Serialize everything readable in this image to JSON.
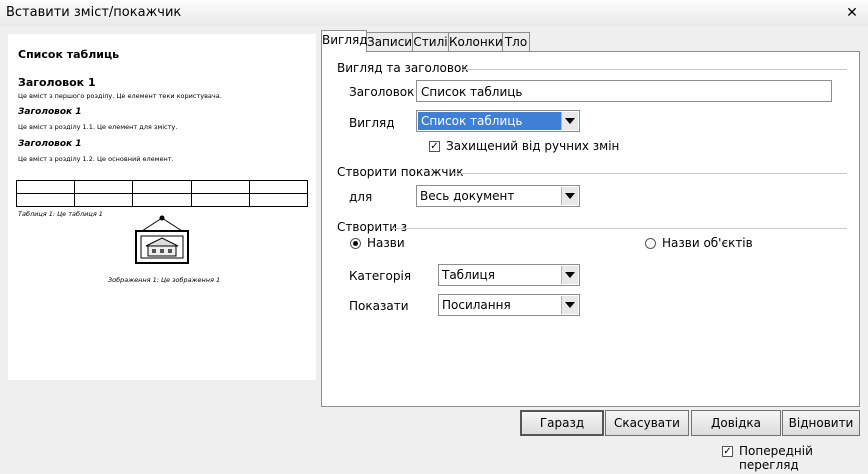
{
  "window": {
    "title": "Вставити зміст/покажчик",
    "close_glyph": "✕"
  },
  "preview": {
    "title": "Список таблиць",
    "heading1": "Заголовок 1",
    "text1": "Це вміст з першого розділу. Це елемент теки користувача.",
    "heading11": "Заголовок 1",
    "text11": "Це вміст з розділу 1.1. Це елемент для змісту.",
    "heading12": "Заголовок 1",
    "text12": "Це вміст з розділу 1.2. Це основний елемент.",
    "table_caption": "Таблиця 1: Це таблиця 1",
    "image_caption": "Зображення 1: Це зображення 1"
  },
  "tabs": [
    "Вигляд",
    "Записи",
    "Стилі",
    "Колонки",
    "Тло"
  ],
  "active_tab": "Вигляд",
  "appearance": {
    "section_label": "Вигляд та заголовок",
    "title_label": "Заголовок",
    "title_value": "Список таблиць",
    "type_label": "Вигляд",
    "type_value": "Список таблиць",
    "protected_label": "Захищений від ручних змін",
    "protected_checked": true
  },
  "create_index": {
    "section_label": "Створити покажчик",
    "for_label": "для",
    "for_value": "Весь документ"
  },
  "create_from": {
    "section_label": "Створити з",
    "captions_label": "Назви",
    "object_names_label": "Назви об'єктів",
    "selected": "Назви",
    "category_label": "Категорія",
    "category_value": "Таблиця",
    "display_label": "Показати",
    "display_value": "Посилання"
  },
  "buttons": {
    "ok": "Гаразд",
    "cancel": "Скасувати",
    "help": "Довідка",
    "reset": "Відновити"
  },
  "preview_toggle": {
    "label": "Попередній перегляд",
    "checked": true
  },
  "colors": {
    "selection": "#3f7fd6",
    "dialog_bg": "#efefef"
  }
}
